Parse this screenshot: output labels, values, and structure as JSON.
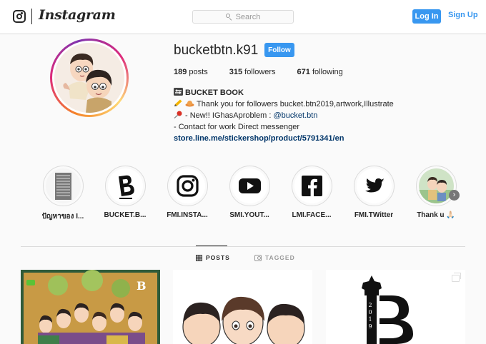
{
  "header": {
    "wordmark": "Instagram",
    "search_placeholder": "Search",
    "login_label": "Log In",
    "signup_label": "Sign Up"
  },
  "profile": {
    "username": "bucketbtn.k91",
    "follow_label": "Follow",
    "stats": [
      {
        "value": "189",
        "label": "posts"
      },
      {
        "value": "315",
        "label": "followers"
      },
      {
        "value": "671",
        "label": "following"
      }
    ],
    "bio": {
      "name": "BUCKET BOOK",
      "line1": "Thank you for followers bucket.btn2019,artwork,Illustrate",
      "line2_prefix": "- New!! IGhasAproblem : ",
      "line2_mention": "@bucket.btn",
      "line3": "- Contact for work Direct messenger",
      "link": "store.line.me/stickershop/product/5791341/en"
    }
  },
  "highlights": [
    {
      "label": "ปัญหาของ I..."
    },
    {
      "label": "BUCKET.B..."
    },
    {
      "label": "FMI.INSTA..."
    },
    {
      "label": "SMI.YOUT..."
    },
    {
      "label": "LMI.FACE..."
    },
    {
      "label": "FMI.TWitter"
    },
    {
      "label": "Thank u 🙏🏻"
    }
  ],
  "tabs": {
    "posts": "POSTS",
    "tagged": "TAGGED"
  },
  "colors": {
    "accent": "#3897f0",
    "link": "#003569",
    "youtube": "#e62117",
    "facebook": "#1d1d1d",
    "twitter": "#1da1f2"
  },
  "icons": [
    "instagram-icon",
    "search-icon",
    "bucket-logo-icon",
    "instagram-icon",
    "youtube-icon",
    "facebook-icon",
    "twitter-icon",
    "chevron-right-icon",
    "grid-icon",
    "tag-icon",
    "carousel-icon"
  ]
}
